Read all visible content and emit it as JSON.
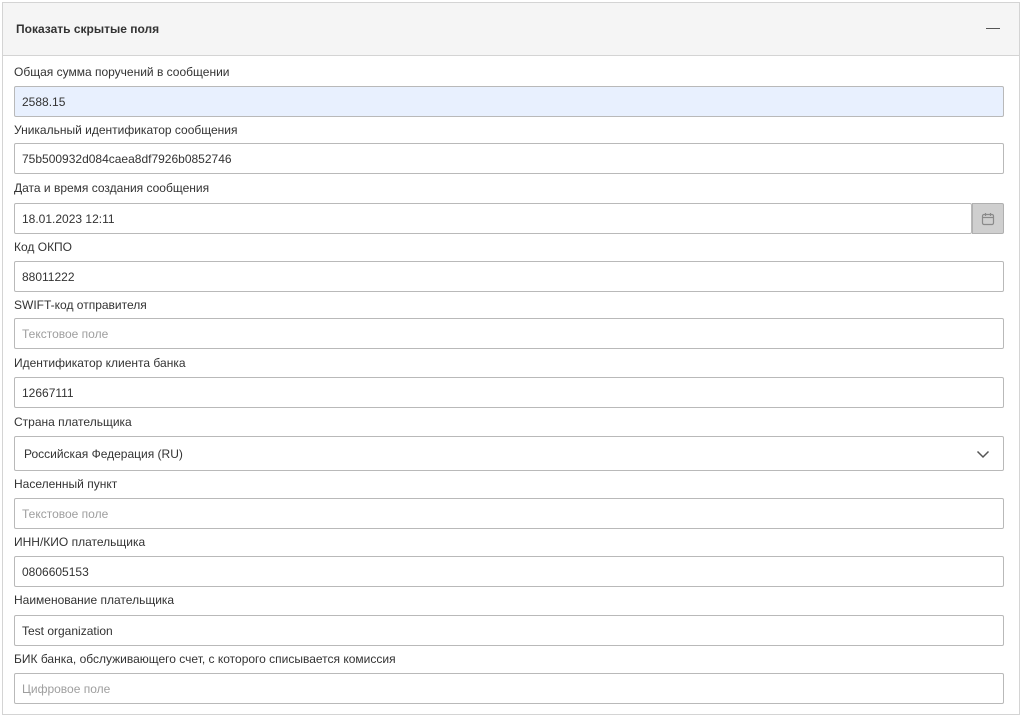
{
  "panel": {
    "title": "Показать скрытые поля",
    "collapse_icon": "minus-icon"
  },
  "fields": {
    "total_amount": {
      "label": "Общая сумма поручений в сообщении",
      "value": "2588.15",
      "placeholder": ""
    },
    "message_id": {
      "label": "Уникальный идентификатор сообщения",
      "value": "75b500932d084caea8df7926b0852746",
      "placeholder": ""
    },
    "created_at": {
      "label": "Дата и время создания сообщения",
      "value": "18.01.2023 12:11",
      "placeholder": "",
      "icon": "calendar-icon"
    },
    "okpo": {
      "label": "Код ОКПО",
      "value": "88011222",
      "placeholder": ""
    },
    "swift": {
      "label": "SWIFT-код отправителя",
      "value": "",
      "placeholder": "Текстовое поле"
    },
    "client_id": {
      "label": "Идентификатор клиента банка",
      "value": "12667111",
      "placeholder": ""
    },
    "country": {
      "label": "Страна плательщика",
      "value": "Российская Федерация (RU)",
      "icon": "chevron-down-icon"
    },
    "locality": {
      "label": "Населенный пункт",
      "value": "",
      "placeholder": "Текстовое поле"
    },
    "inn": {
      "label": "ИНН/КИО плательщика",
      "value": "0806605153",
      "placeholder": ""
    },
    "payer_name": {
      "label": "Наименование плательщика",
      "value": "Test organization",
      "placeholder": ""
    },
    "bik": {
      "label": "БИК банка, обслуживающего счет, с которого списывается комиссия",
      "value": "",
      "placeholder": "Цифровое поле"
    }
  },
  "colors": {
    "highlight_bg": "#e8f0fe",
    "header_bg": "#f5f5f5",
    "border": "#b9b9b9"
  }
}
